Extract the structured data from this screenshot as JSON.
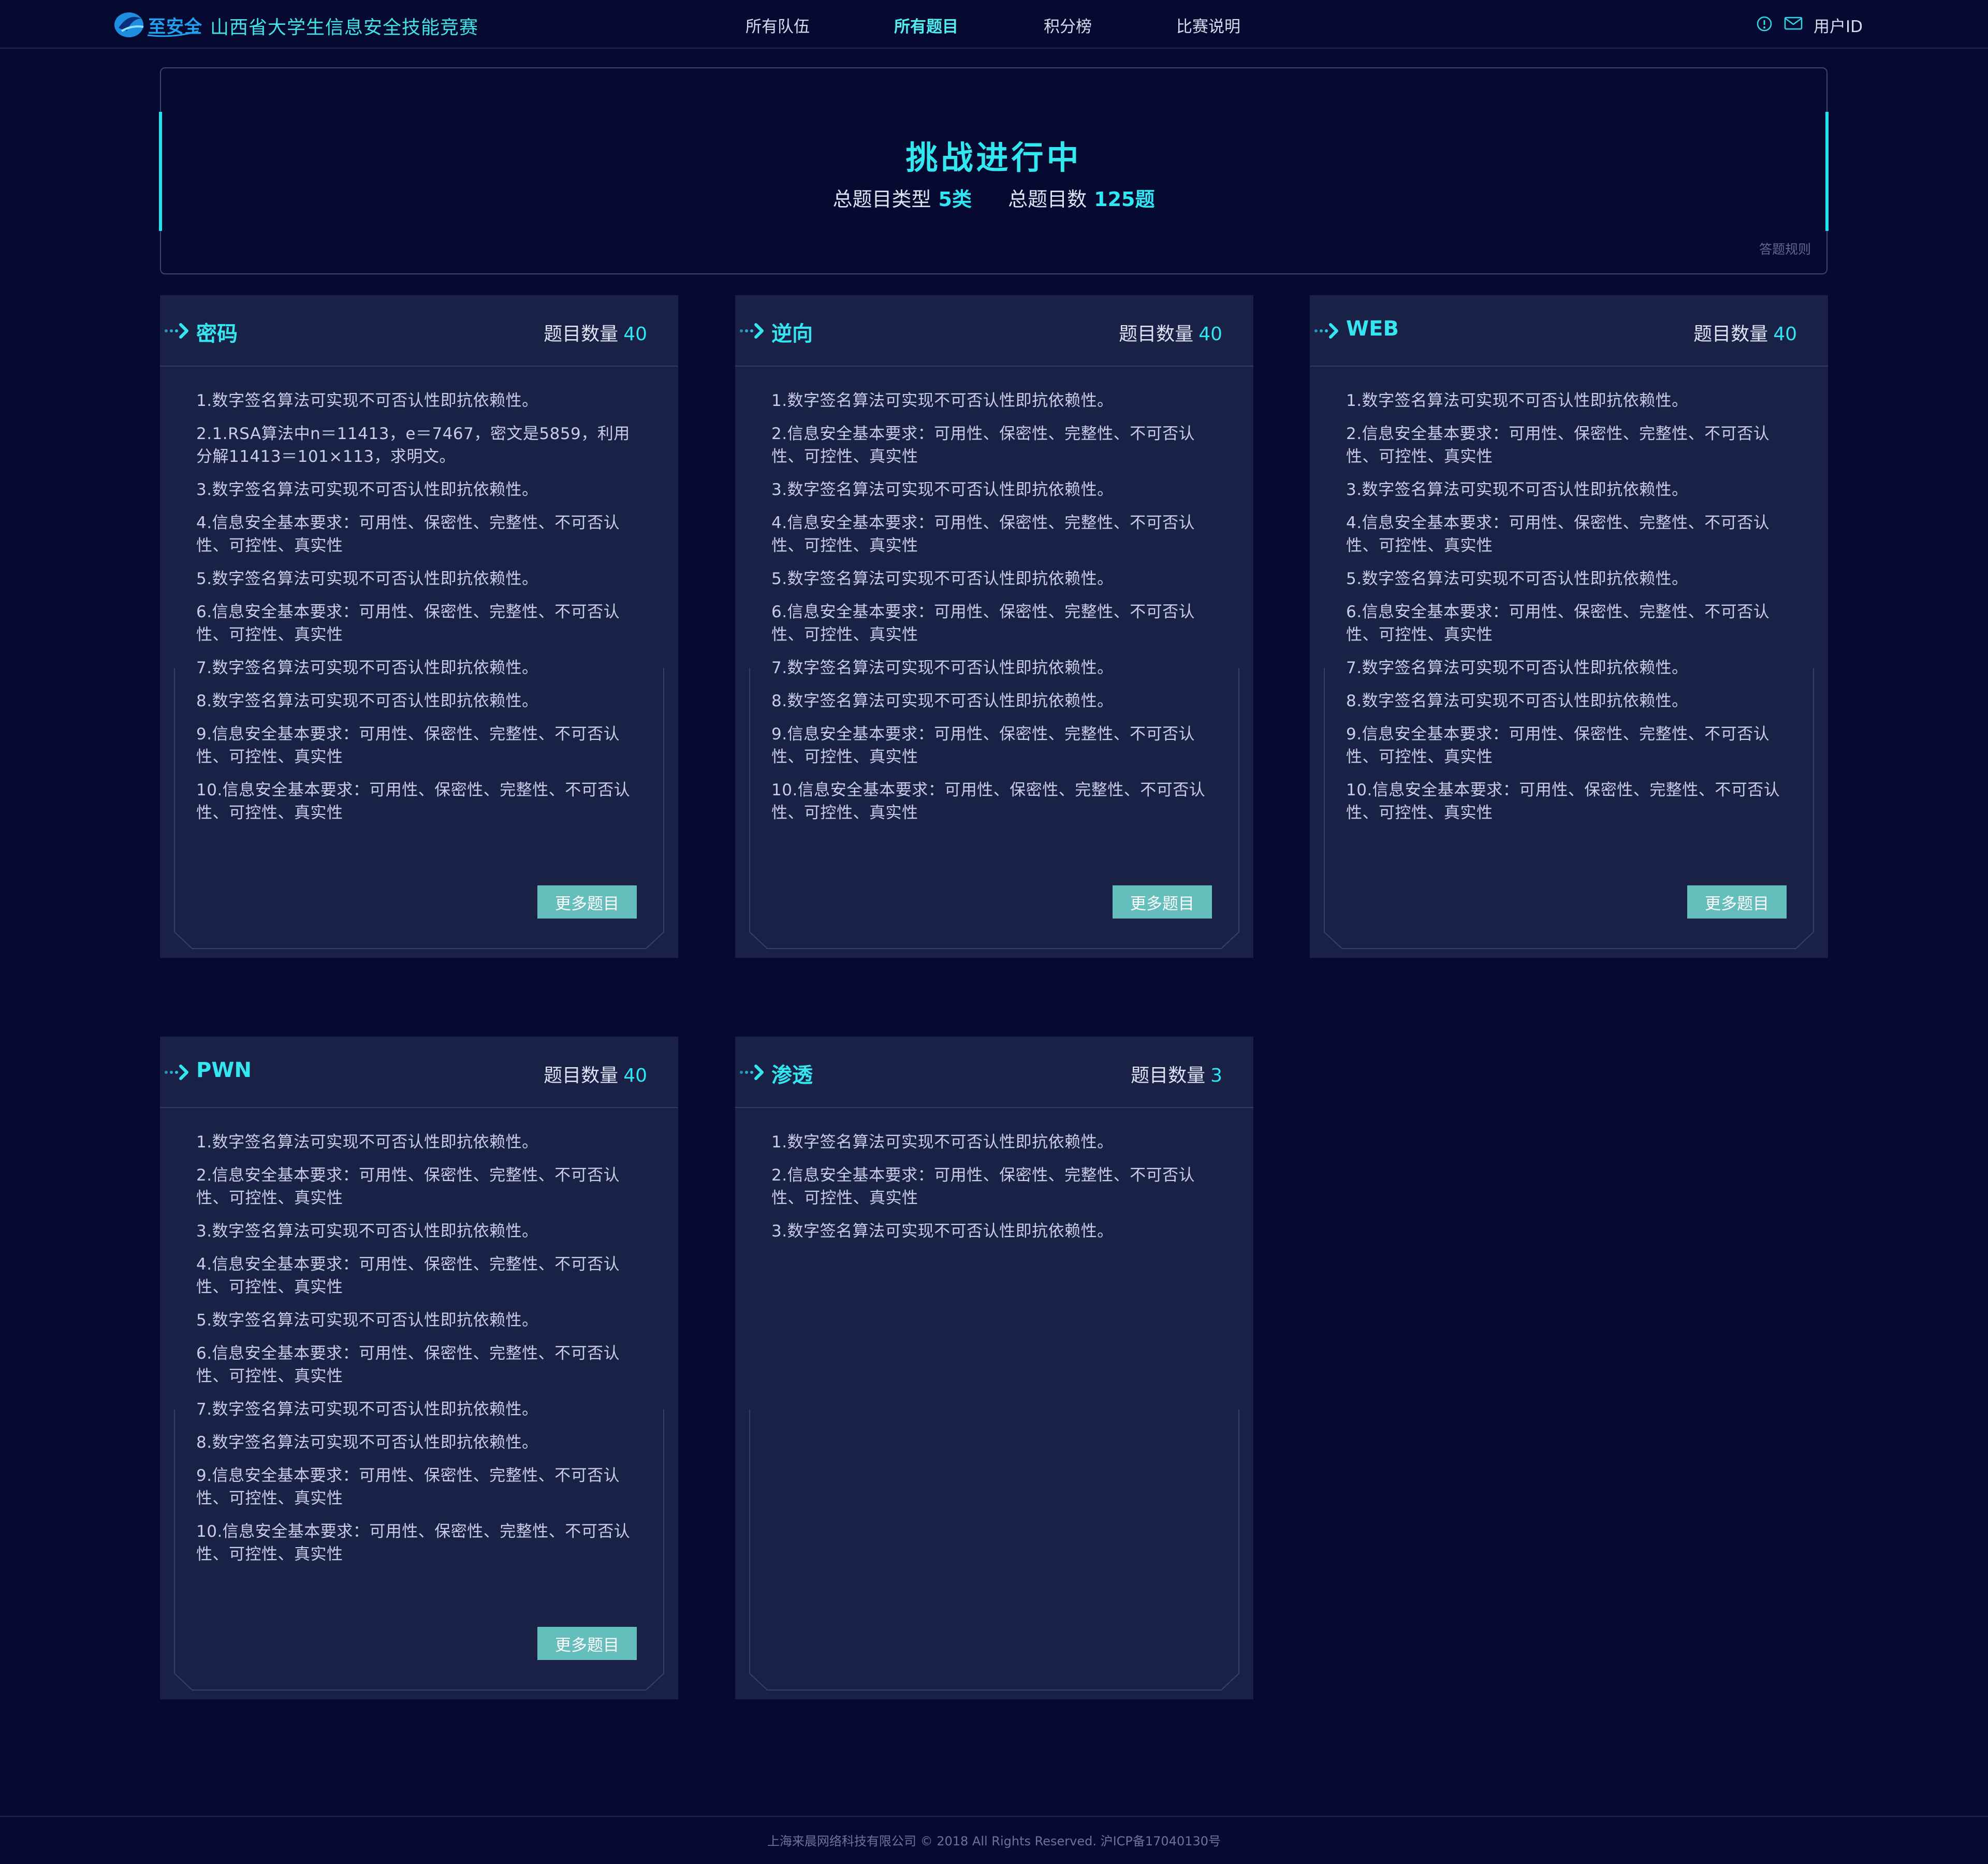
{
  "header": {
    "logo_text": "至安全",
    "site_title": "山西省大学生信息安全技能竞赛",
    "nav": [
      "所有队伍",
      "所有题目",
      "积分榜",
      "比赛说明"
    ],
    "active_nav": "所有题目",
    "user_label": "用户ID"
  },
  "banner": {
    "title": "挑战进行中",
    "type_label": "总题目类型",
    "type_value": "5类",
    "count_label": "总题目数",
    "count_value": "125题",
    "rules_link": "答题规则"
  },
  "categories": [
    {
      "name": "密码",
      "count_label": "题目数量",
      "count": "40",
      "more_label": "更多题目",
      "questions": [
        "1.数字签名算法可实现不可否认性即抗依赖性。",
        "2.1.RSA算法中n＝11413，e＝7467，密文是5859，利用分解11413＝101×113，求明文。",
        "3.数字签名算法可实现不可否认性即抗依赖性。",
        "4.信息安全基本要求：可用性、保密性、完整性、不可否认性、可控性、真实性",
        "5.数字签名算法可实现不可否认性即抗依赖性。",
        "6.信息安全基本要求：可用性、保密性、完整性、不可否认性、可控性、真实性",
        "7.数字签名算法可实现不可否认性即抗依赖性。",
        "8.数字签名算法可实现不可否认性即抗依赖性。",
        "9.信息安全基本要求：可用性、保密性、完整性、不可否认性、可控性、真实性",
        "10.信息安全基本要求：可用性、保密性、完整性、不可否认性、可控性、真实性"
      ]
    },
    {
      "name": "逆向",
      "count_label": "题目数量",
      "count": "40",
      "more_label": "更多题目",
      "questions": [
        "1.数字签名算法可实现不可否认性即抗依赖性。",
        "2.信息安全基本要求：可用性、保密性、完整性、不可否认性、可控性、真实性",
        "3.数字签名算法可实现不可否认性即抗依赖性。",
        "4.信息安全基本要求：可用性、保密性、完整性、不可否认性、可控性、真实性",
        "5.数字签名算法可实现不可否认性即抗依赖性。",
        "6.信息安全基本要求：可用性、保密性、完整性、不可否认性、可控性、真实性",
        "7.数字签名算法可实现不可否认性即抗依赖性。",
        "8.数字签名算法可实现不可否认性即抗依赖性。",
        "9.信息安全基本要求：可用性、保密性、完整性、不可否认性、可控性、真实性",
        "10.信息安全基本要求：可用性、保密性、完整性、不可否认性、可控性、真实性"
      ]
    },
    {
      "name": "WEB",
      "count_label": "题目数量",
      "count": "40",
      "more_label": "更多题目",
      "questions": [
        "1.数字签名算法可实现不可否认性即抗依赖性。",
        "2.信息安全基本要求：可用性、保密性、完整性、不可否认性、可控性、真实性",
        "3.数字签名算法可实现不可否认性即抗依赖性。",
        "4.信息安全基本要求：可用性、保密性、完整性、不可否认性、可控性、真实性",
        "5.数字签名算法可实现不可否认性即抗依赖性。",
        "6.信息安全基本要求：可用性、保密性、完整性、不可否认性、可控性、真实性",
        "7.数字签名算法可实现不可否认性即抗依赖性。",
        "8.数字签名算法可实现不可否认性即抗依赖性。",
        "9.信息安全基本要求：可用性、保密性、完整性、不可否认性、可控性、真实性",
        "10.信息安全基本要求：可用性、保密性、完整性、不可否认性、可控性、真实性"
      ]
    },
    {
      "name": "PWN",
      "count_label": "题目数量",
      "count": "40",
      "more_label": "更多题目",
      "questions": [
        "1.数字签名算法可实现不可否认性即抗依赖性。",
        "2.信息安全基本要求：可用性、保密性、完整性、不可否认性、可控性、真实性",
        "3.数字签名算法可实现不可否认性即抗依赖性。",
        "4.信息安全基本要求：可用性、保密性、完整性、不可否认性、可控性、真实性",
        "5.数字签名算法可实现不可否认性即抗依赖性。",
        "6.信息安全基本要求：可用性、保密性、完整性、不可否认性、可控性、真实性",
        "7.数字签名算法可实现不可否认性即抗依赖性。",
        "8.数字签名算法可实现不可否认性即抗依赖性。",
        "9.信息安全基本要求：可用性、保密性、完整性、不可否认性、可控性、真实性",
        "10.信息安全基本要求：可用性、保密性、完整性、不可否认性、可控性、真实性"
      ]
    },
    {
      "name": "渗透",
      "count_label": "题目数量",
      "count": "3",
      "more_label": "",
      "questions": [
        "1.数字签名算法可实现不可否认性即抗依赖性。",
        "2.信息安全基本要求：可用性、保密性、完整性、不可否认性、可控性、真实性",
        "3.数字签名算法可实现不可否认性即抗依赖性。"
      ]
    }
  ],
  "footer": {
    "text": "上海来晨网络科技有限公司 © 2018 All Rights Reserved.  沪ICP备17040130号"
  },
  "colors": {
    "background": "#070a30",
    "card": "#1a2146",
    "accent": "#2fe6f2",
    "button": "#64bebc"
  }
}
